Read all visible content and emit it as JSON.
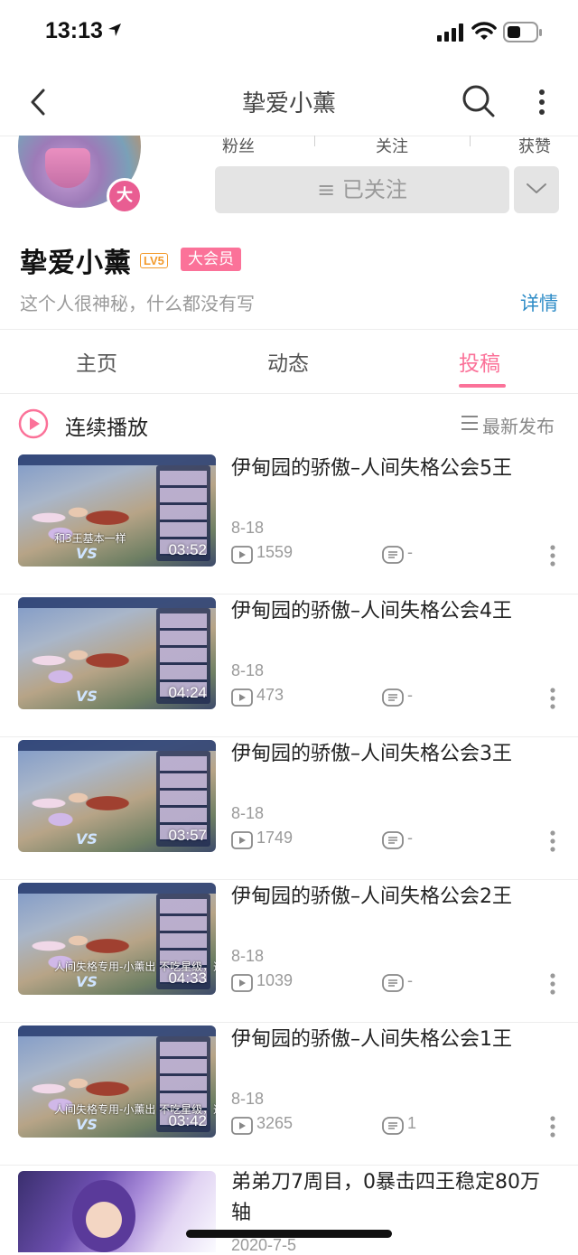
{
  "status_bar": {
    "time": "13:13"
  },
  "nav": {
    "title": "挚爱小薰"
  },
  "profile": {
    "avatar_badge": "大",
    "stats": {
      "fans_label": "粉丝",
      "follow_label": "关注",
      "likes_label": "获赞"
    },
    "followed_button": "≡ 已关注",
    "name": "挚爱小薰",
    "level": "LV5",
    "member_badge": "大会员",
    "bio": "这个人很神秘，什么都没有写",
    "detail_link": "详情"
  },
  "tabs": [
    {
      "label": "主页",
      "active": false
    },
    {
      "label": "动态",
      "active": false
    },
    {
      "label": "投稿",
      "active": true
    }
  ],
  "play_row": {
    "label": "连续播放",
    "sort_label": "最新发布"
  },
  "videos": [
    {
      "title": "伊甸园的骄傲–人间失格公会5王",
      "duration": "03:52",
      "date": "8-18",
      "views": "1559",
      "danmaku": "-",
      "thumb_caption": "和3王基本一样"
    },
    {
      "title": "伊甸园的骄傲–人间失格公会4王",
      "duration": "04:24",
      "date": "8-18",
      "views": "473",
      "danmaku": "-",
      "thumb_caption": ""
    },
    {
      "title": "伊甸园的骄傲–人间失格公会3王",
      "duration": "03:57",
      "date": "8-18",
      "views": "1749",
      "danmaku": "-",
      "thumb_caption": ""
    },
    {
      "title": "伊甸园的骄傲–人间失格公会2王",
      "duration": "04:33",
      "date": "8-18",
      "views": "1039",
      "danmaku": "-",
      "thumb_caption": "人间失格专用-小薰出 不吃星级，通用版"
    },
    {
      "title": "伊甸园的骄傲–人间失格公会1王",
      "duration": "03:42",
      "date": "8-18",
      "views": "3265",
      "danmaku": "1",
      "thumb_caption": "人间失格专用-小薰出 不吃星级，通用版"
    }
  ],
  "last_video": {
    "title": "弟弟刀7周目，0暴击四王稳定80万轴",
    "date": "2020-7-5"
  },
  "colors": {
    "accent_pink": "#fb7299",
    "link_blue": "#2e8cc7",
    "level_orange": "#f39a2b"
  }
}
